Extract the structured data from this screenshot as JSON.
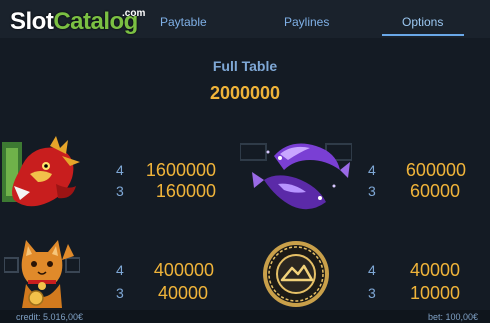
{
  "logo": {
    "part1": "Slot",
    "part2": "Catalog",
    "suffix": ".com"
  },
  "tabs": [
    {
      "label": "Paytable"
    },
    {
      "label": "Paylines"
    },
    {
      "label": "Options"
    }
  ],
  "full_table": {
    "title": "Full Table",
    "value": "2000000"
  },
  "symbols": [
    {
      "name": "dragon",
      "pays": [
        {
          "count": "4",
          "amount": "1600000"
        },
        {
          "count": "3",
          "amount": "160000"
        }
      ]
    },
    {
      "name": "koi",
      "pays": [
        {
          "count": "4",
          "amount": "600000"
        },
        {
          "count": "3",
          "amount": "60000"
        }
      ]
    },
    {
      "name": "lucky-cat",
      "pays": [
        {
          "count": "4",
          "amount": "400000"
        },
        {
          "count": "3",
          "amount": "40000"
        }
      ]
    },
    {
      "name": "gold-coin",
      "pays": [
        {
          "count": "4",
          "amount": "40000"
        },
        {
          "count": "3",
          "amount": "10000"
        }
      ]
    }
  ],
  "footer": {
    "credit": "credit: 5.016,00€",
    "bet": "bet: 100,00€"
  },
  "colors": {
    "accent": "#6aa8e8",
    "gold": "#f0b43a",
    "label": "#7fa8d6",
    "background": "#141b24"
  }
}
